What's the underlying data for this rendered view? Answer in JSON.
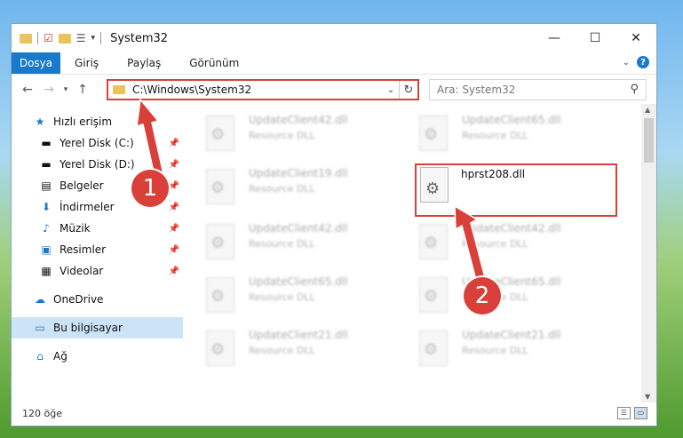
{
  "window": {
    "title": "System32",
    "controls": {
      "minimize": "—",
      "maximize": "☐",
      "close": "✕"
    }
  },
  "ribbon": {
    "file_tab": "Dosya",
    "tabs": [
      "Giriş",
      "Paylaş",
      "Görünüm"
    ]
  },
  "address": {
    "path": "C:\\Windows\\System32",
    "search_placeholder": "Ara: System32"
  },
  "nav": {
    "quick_access": "Hızlı erişim",
    "pinned": [
      {
        "label": "Yerel Disk (C:)",
        "icon": "drive-icon"
      },
      {
        "label": "Yerel Disk (D:)",
        "icon": "drive-icon"
      },
      {
        "label": "Belgeler",
        "icon": "documents-icon"
      },
      {
        "label": "İndirmeler",
        "icon": "downloads-icon"
      },
      {
        "label": "Müzik",
        "icon": "music-icon"
      },
      {
        "label": "Resimler",
        "icon": "pictures-icon"
      },
      {
        "label": "Videolar",
        "icon": "videos-icon"
      }
    ],
    "onedrive": "OneDrive",
    "this_pc": "Bu bilgisayar",
    "network": "Ağ"
  },
  "files": {
    "left": [
      {
        "name": "UpdateClient42.dll",
        "type": "Resource DLL"
      },
      {
        "name": "UpdateClient19.dll",
        "type": "Resource DLL"
      },
      {
        "name": "UpdateClient42.dll",
        "type": "Resource DLL"
      },
      {
        "name": "UpdateClient65.dll",
        "type": "Resource DLL"
      },
      {
        "name": "UpdateClient21.dll",
        "type": "Resource DLL"
      }
    ],
    "right": [
      {
        "name": "UpdateClient65.dll",
        "type": "Resource DLL"
      },
      {
        "name": "UpdateClient42.dll",
        "type": "Resource DLL"
      },
      {
        "name": "UpdateClient65.dll",
        "type": "Resource DLL"
      },
      {
        "name": "UpdateClient21.dll",
        "type": "Resource DLL"
      }
    ],
    "highlighted": "hprst208.dll"
  },
  "status": {
    "count": "120 öğe"
  },
  "annotations": {
    "step1": "1",
    "step2": "2"
  },
  "colors": {
    "accent": "#1979ca",
    "annotation": "#d9403a"
  }
}
